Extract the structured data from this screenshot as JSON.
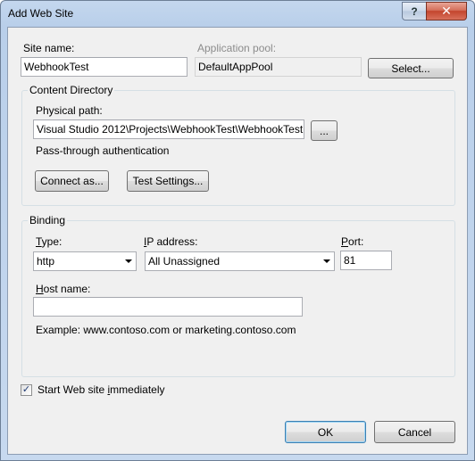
{
  "window": {
    "title": "Add Web Site",
    "help_glyph": "?",
    "close_glyph": "✕"
  },
  "site": {
    "name_label": "Site name:",
    "name_value": "WebhookTest",
    "pool_label": "Application pool:",
    "pool_value": "DefaultAppPool",
    "select_button": "Select..."
  },
  "content": {
    "group_title": "Content Directory",
    "path_label": "Physical path:",
    "path_value": "Visual Studio 2012\\Projects\\WebhookTest\\WebhookTest",
    "browse_button": "...",
    "auth_label": "Pass-through authentication",
    "connect_button": "Connect as...",
    "test_button": "Test Settings..."
  },
  "binding": {
    "group_title": "Binding",
    "type_label_first": "T",
    "type_label_rest": "ype:",
    "type_value": "http",
    "ip_label_first": "I",
    "ip_label_rest": "P address:",
    "ip_value": "All Unassigned",
    "port_label_first": "P",
    "port_label_rest": "ort:",
    "port_value": "81",
    "host_label_first": "H",
    "host_label_rest": "ost name:",
    "host_value": "",
    "example_text": "Example: www.contoso.com or marketing.contoso.com"
  },
  "start": {
    "label_pre": "Start Web site ",
    "label_u": "i",
    "label_post": "mmediately",
    "checked": true,
    "check_glyph": "✓"
  },
  "footer": {
    "ok_button": "OK",
    "cancel_button": "Cancel"
  }
}
